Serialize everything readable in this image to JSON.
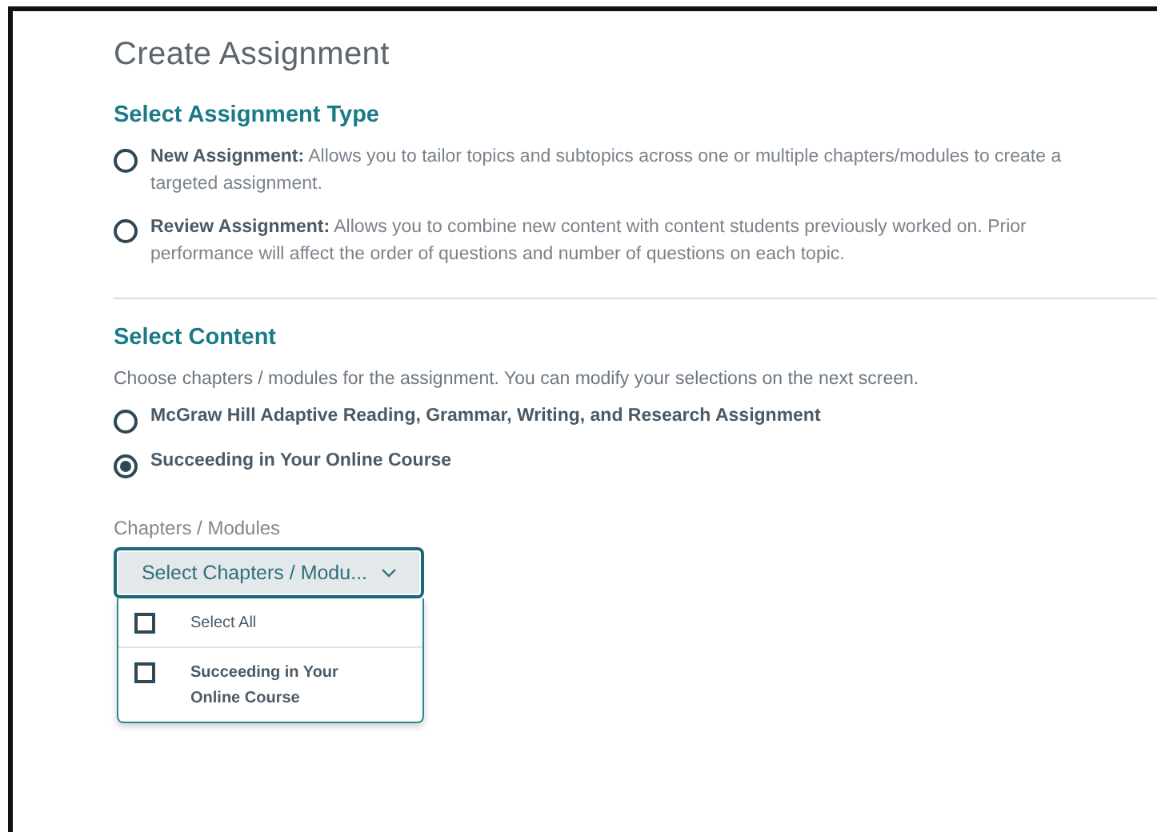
{
  "title": "Create Assignment",
  "assignment_type": {
    "heading": "Select Assignment Type",
    "options": [
      {
        "text": "**New Assignment:** Allows you to tailor topics and subtopics across one or multiple chapters/modules to create a targeted assignment.",
        "selected": false
      },
      {
        "text": "**Review Assignment:** Allows you to combine new content with content students previously worked on. Prior performance will affect the order of questions and number of questions on each topic.",
        "selected": false
      }
    ]
  },
  "content": {
    "heading": "Select Content",
    "description": "Choose chapters / modules for the assignment. You can modify your selections on the next screen.",
    "options": [
      {
        "label": "McGraw Hill Adaptive Reading, Grammar, Writing, and Research Assignment",
        "selected": false
      },
      {
        "label": "Succeeding in Your Online Course",
        "selected": true
      }
    ]
  },
  "chapters": {
    "label": "Chapters / Modules",
    "value": "Select Chapters / Modu...",
    "expanded": true,
    "items": [
      {
        "label": "Select All",
        "checked": false,
        "kind": "all"
      },
      {
        "label": "Succeeding in Your Online Course",
        "checked": false,
        "kind": "chapter"
      }
    ]
  }
}
